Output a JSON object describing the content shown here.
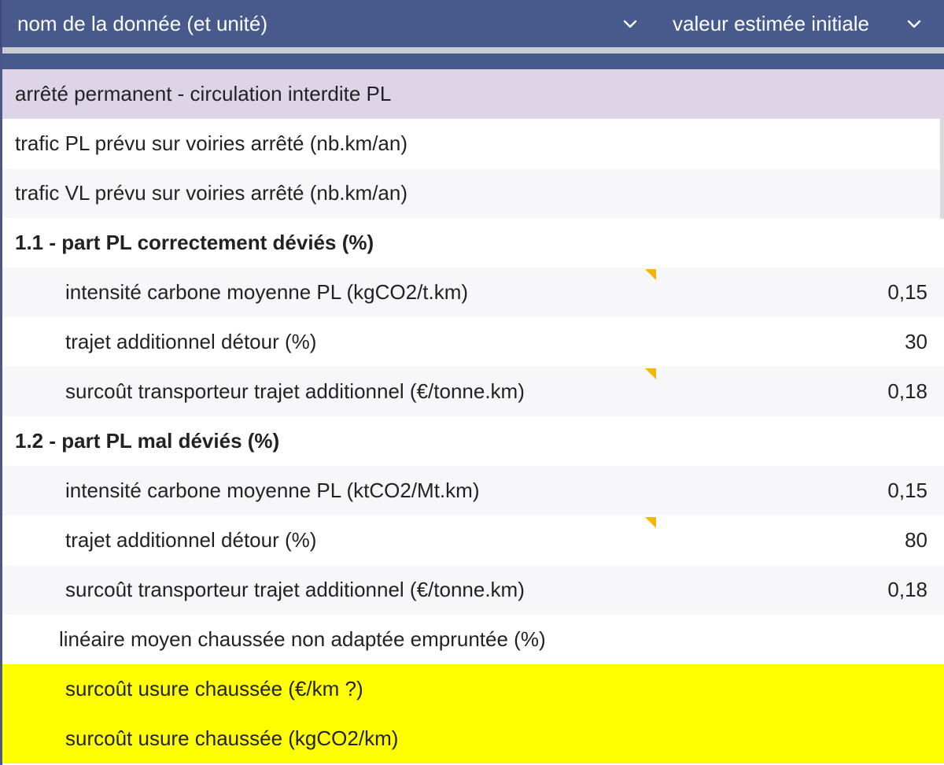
{
  "header": {
    "col1_label": "nom de la donnée (et unité)",
    "col2_label": "valeur estimée initiale",
    "chevron_icon": "chevron-down-icon",
    "background": "#485a8c"
  },
  "rows": [
    {
      "label": "arrêté permanent - circulation interdite PL",
      "value": "",
      "style": "purple"
    },
    {
      "label": "trafic PL prévu sur voiries arrêté (nb.km/an)",
      "value": ""
    },
    {
      "label": "trafic VL prévu sur voiries arrêté (nb.km/an)",
      "value": ""
    },
    {
      "label": "1.1 - part PL correctement déviés (%)",
      "value": "",
      "bold": true
    },
    {
      "label": "intensité carbone moyenne PL (kgCO2/t.km)",
      "value": "0,15",
      "flag": true
    },
    {
      "label": "trajet additionnel détour (%)",
      "value": "30"
    },
    {
      "label": "surcoût transporteur trajet additionnel (€/tonne.km)",
      "value": "0,18",
      "flag": true
    },
    {
      "label": "1.2 - part PL mal déviés (%)",
      "value": "",
      "bold": true
    },
    {
      "label": "intensité carbone moyenne PL (ktCO2/Mt.km)",
      "value": "0,15"
    },
    {
      "label": "trajet additionnel détour (%)",
      "value": "80",
      "flag": true
    },
    {
      "label": "surcoût transporteur trajet additionnel (€/tonne.km)",
      "value": "0,18"
    },
    {
      "label": "linéaire moyen chaussée non adaptée empruntée (%)",
      "value": ""
    },
    {
      "label": "surcoût usure chaussée (€/km ?)",
      "value": "",
      "style": "yellow"
    },
    {
      "label": "surcoût usure chaussée (kgCO2/km)",
      "value": "",
      "style": "yellow"
    }
  ],
  "colors": {
    "header": "#485a8c",
    "highlight_purple": "#ddd4e8",
    "highlight_yellow": "#ffff00",
    "comment_flag": "#f2b705"
  }
}
